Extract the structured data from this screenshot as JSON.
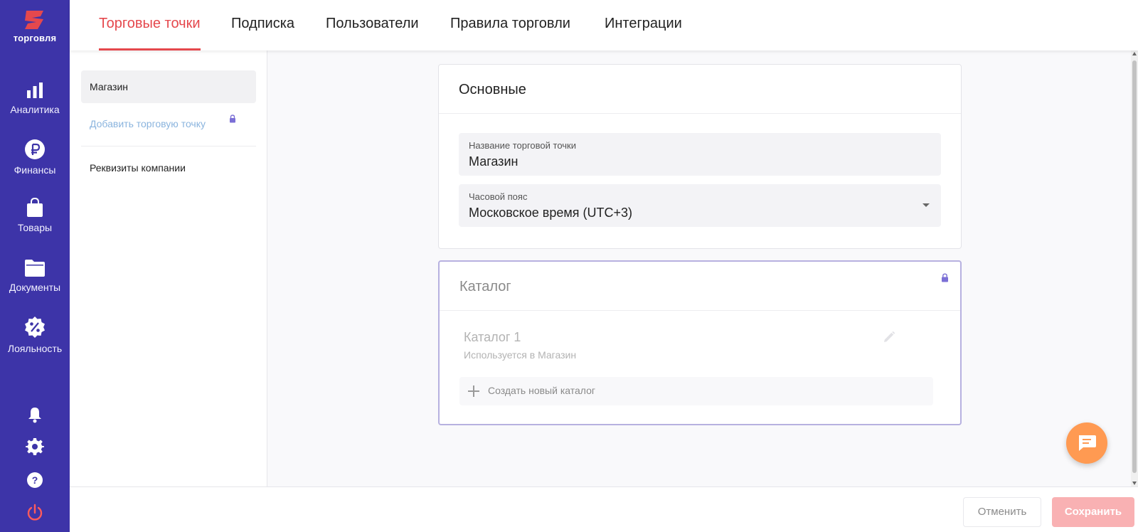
{
  "brand": {
    "name": "торговля",
    "accent": "#e5484d",
    "sidebar_bg": "#3d34a8"
  },
  "sidebar": {
    "items": [
      {
        "label": "Аналитика",
        "icon": "bar-chart-icon"
      },
      {
        "label": "Финансы",
        "icon": "ruble-icon"
      },
      {
        "label": "Товары",
        "icon": "shopping-bag-icon"
      },
      {
        "label": "Документы",
        "icon": "folder-icon"
      },
      {
        "label": "Лояльность",
        "icon": "percent-badge-icon"
      }
    ],
    "bottom_icons": [
      "bell-icon",
      "gear-icon",
      "help-icon",
      "power-icon"
    ]
  },
  "tabs": [
    {
      "label": "Торговые точки",
      "active": true
    },
    {
      "label": "Подписка"
    },
    {
      "label": "Пользователи"
    },
    {
      "label": "Правила торговли"
    },
    {
      "label": "Интеграции"
    }
  ],
  "submenu": {
    "items": [
      {
        "label": "Магазин",
        "selected": true
      },
      {
        "label": "Добавить торговую точку",
        "locked": true
      },
      {
        "label": "Реквизиты компании"
      }
    ]
  },
  "main_card": {
    "title": "Основные",
    "fields": [
      {
        "label": "Название торговой точки",
        "value": "Магазин"
      },
      {
        "label": "Часовой пояс",
        "value": "Московское время (UTC+3)"
      }
    ]
  },
  "catalog_card": {
    "title": "Каталог",
    "locked": true,
    "catalog_name": "Каталог 1",
    "catalog_usage": "Используется в Магазин",
    "create_label": "Создать новый каталог"
  },
  "footer": {
    "cancel_label": "Отменить",
    "save_label": "Сохранить"
  }
}
